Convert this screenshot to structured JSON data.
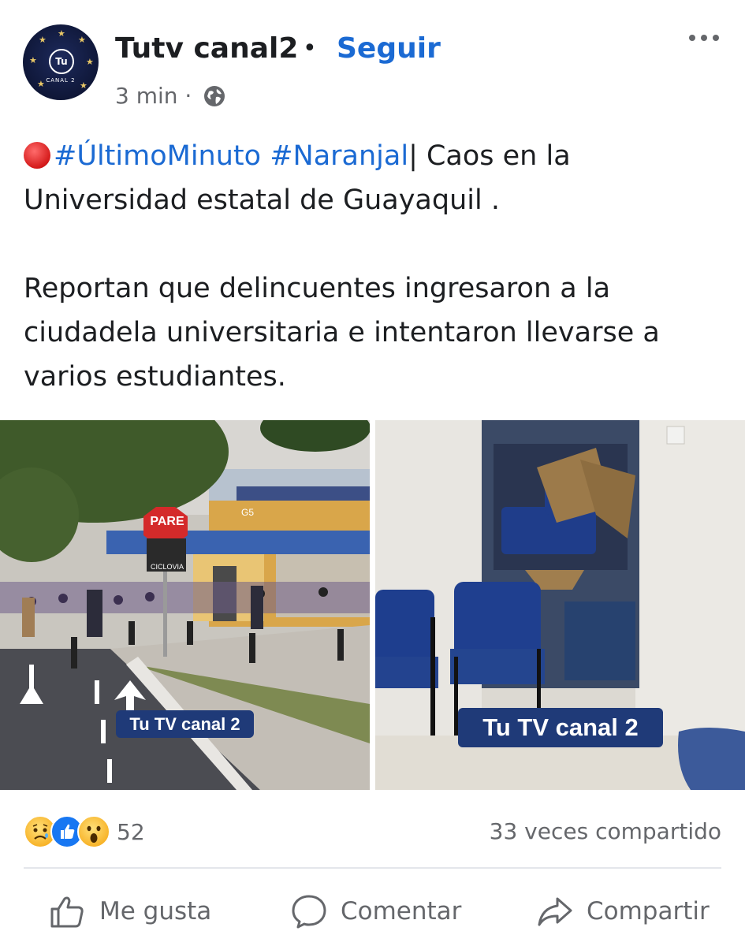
{
  "post": {
    "page_name": "Tutv canal2",
    "separator": "•",
    "follow_label": "Seguir",
    "time": "3 min",
    "time_separator": "·",
    "avatar": {
      "logo_text": "Tu",
      "sub_text": "CANAL 2"
    },
    "text": {
      "hashtag_1": "#ÚltimoMinuto",
      "hashtag_2": "#Naranjal",
      "headline_rest": "| Caos en la Universidad estatal de Guayaquil .",
      "body": "Reportan que delincuentes ingresaron a la ciudadela universitaria e intentaron llevarse a varios estudiantes."
    },
    "photos": {
      "left": {
        "watermark": "Tu TV canal 2",
        "stop_sign": "PARE",
        "bike_sign": "CICLOVIA",
        "building_sign": "G5"
      },
      "right": {
        "watermark": "Tu TV canal 2"
      }
    },
    "reactions": {
      "icons": [
        "sad-icon",
        "like-icon",
        "wow-icon"
      ],
      "count": "52"
    },
    "shares": "33 veces compartido",
    "actions": {
      "like": "Me gusta",
      "comment": "Comentar",
      "share": "Compartir"
    }
  },
  "colors": {
    "link_blue": "#1b6ad3",
    "secondary_text": "#65676b",
    "primary_text": "#1c1e21",
    "watermark_bg": "#1f3a78"
  }
}
